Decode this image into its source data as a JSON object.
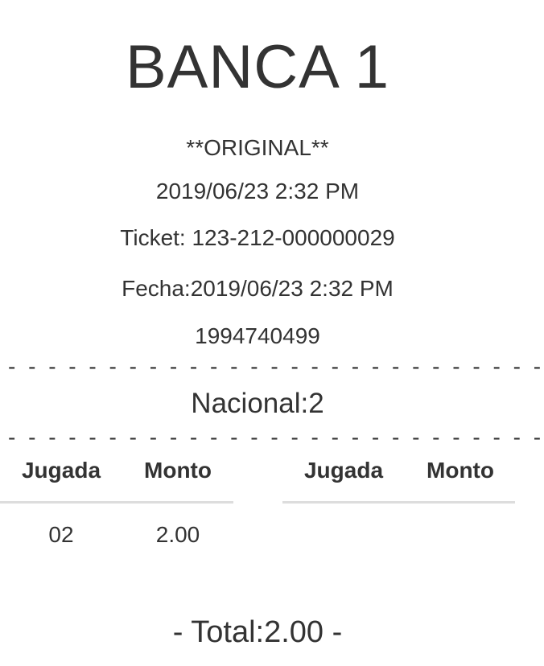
{
  "ticket": {
    "bank_name": "BANCA 1",
    "copy_label": "**ORIGINAL**",
    "datetime": "2019/06/23 2:32 PM",
    "ticket_line": "Ticket: 123-212-000000029",
    "fecha_line": "Fecha:2019/06/23 2:32 PM",
    "code": "1994740499",
    "separator": "- - - - - - - - - - - - - - - - - - - - - - - - - - - -",
    "lottery": "Nacional:2"
  },
  "table": {
    "headers": [
      "Jugada",
      "Monto",
      "Jugada",
      "Monto"
    ],
    "rows": [
      {
        "jugada": "02",
        "monto": "2.00"
      }
    ]
  },
  "total_line": "- Total:2.00 -"
}
